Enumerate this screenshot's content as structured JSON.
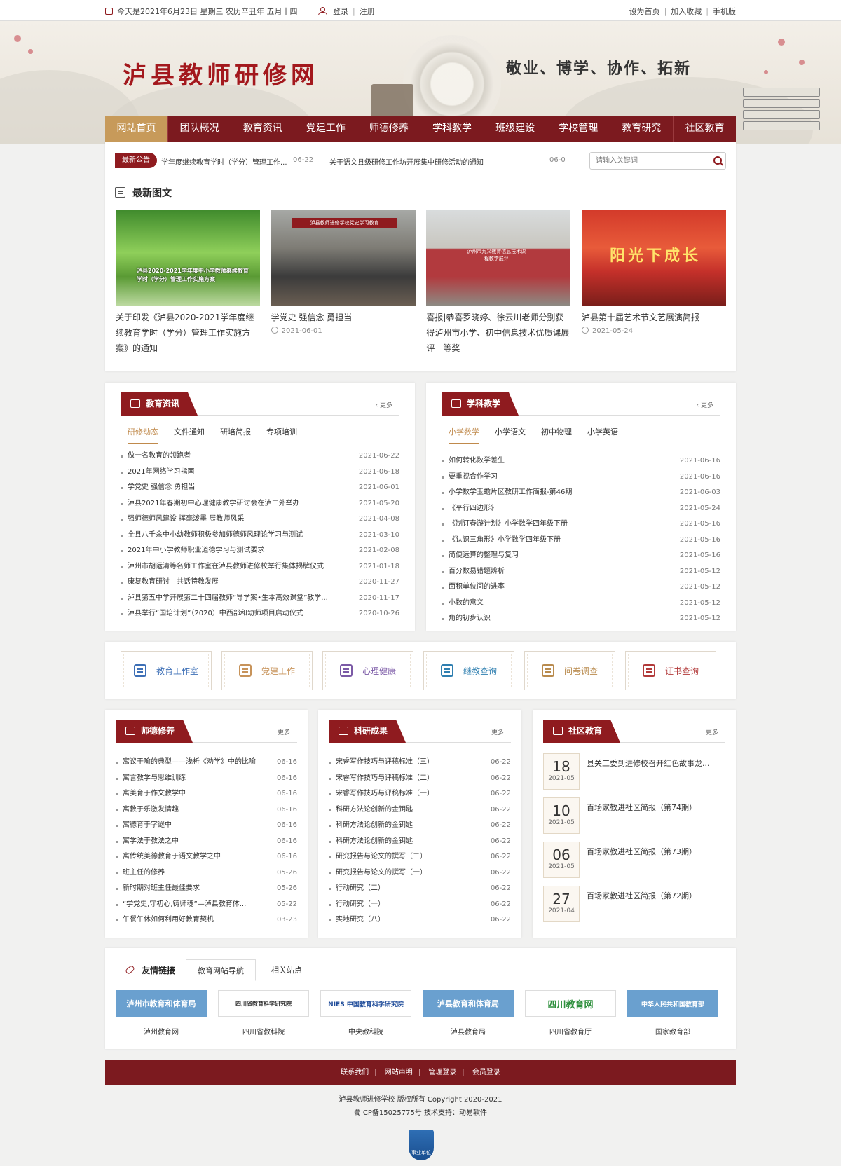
{
  "topbar": {
    "date_text": "今天是2021年6月23日 星期三 农历辛丑年 五月十四",
    "login": "登录",
    "register": "注册",
    "set_home": "设为首页",
    "add_fav": "加入收藏",
    "mobile": "手机版"
  },
  "banner": {
    "title": "泸县教师研修网",
    "motto": "敬业、博学、协作、拓新"
  },
  "nav": [
    "网站首页",
    "团队概况",
    "教育资讯",
    "党建工作",
    "师德修养",
    "学科教学",
    "班级建设",
    "学校管理",
    "教育研究",
    "社区教育"
  ],
  "notice": {
    "tag": "最新公告",
    "item1": "学年度继续教育学时（学分）管理工作...",
    "date1": "06-22",
    "item2": "关于语文县级研修工作坊开展集中研修活动的通知",
    "date2": "06-0"
  },
  "search": {
    "placeholder": "请输入关键词"
  },
  "latest": {
    "title": "最新图文",
    "items": [
      {
        "caption": "关于印发《泸县2020-2021学年度继续教育学时（学分）管理工作实施方案》的通知",
        "date": "",
        "overlay": "泸县2020-2021学年度中小学教师继续教育学时（学分）管理工作实施方案"
      },
      {
        "caption": "学党史 强信念 勇担当",
        "date": "2021-06-01",
        "overlay": "泸县教师进修学校党史学习教育"
      },
      {
        "caption": "喜报|恭喜罗晓婷、徐云川老师分别获得泸州市小学、初中信息技术优质课展评一等奖",
        "date": "",
        "overlay": "泸州市九义教育信息技术课程教学展评"
      },
      {
        "caption": "泸县第十届艺术节文艺展演简报",
        "date": "2021-05-24",
        "overlay": "阳光下成长"
      }
    ]
  },
  "edu_news": {
    "title": "教育资讯",
    "more": "更多",
    "tabs": [
      "研修动态",
      "文件通知",
      "研培简报",
      "专项培训"
    ],
    "rows": [
      {
        "t": "做一名教育的领跑者",
        "d": "2021-06-22"
      },
      {
        "t": "2021年网络学习指南",
        "d": "2021-06-18"
      },
      {
        "t": "学党史 强信念 勇担当",
        "d": "2021-06-01"
      },
      {
        "t": "泸县2021年春期初中心理健康教学研讨会在泸二外举办",
        "d": "2021-05-20"
      },
      {
        "t": "强师德师风建设 挥毫泼墨 展教师风采",
        "d": "2021-04-08"
      },
      {
        "t": "全县八千余中小幼教师积极参加师德师风理论学习与测试",
        "d": "2021-03-10"
      },
      {
        "t": "2021年中小学教师职业道德学习与测试要求",
        "d": "2021-02-08"
      },
      {
        "t": "泸州市胡运清等名师工作室在泸县教师进修校举行集体揭牌仪式",
        "d": "2021-01-18"
      },
      {
        "t": "康复教育研讨　共话特教发展",
        "d": "2020-11-27"
      },
      {
        "t": "泸县第五中学开展第二十四届教师“导学案•生本高效课堂”教学...",
        "d": "2020-11-17"
      },
      {
        "t": "泸县举行“国培计划”（2020）中西部和幼师项目启动仪式",
        "d": "2020-10-26"
      }
    ]
  },
  "subject": {
    "title": "学科教学",
    "more": "更多",
    "tabs": [
      "小学数学",
      "小学语文",
      "初中物理",
      "小学英语"
    ],
    "rows": [
      {
        "t": "如何转化数学差生",
        "d": "2021-06-16"
      },
      {
        "t": "要重视合作学习",
        "d": "2021-06-16"
      },
      {
        "t": "小学数学玉蟾片区教研工作简报-第46期",
        "d": "2021-06-03"
      },
      {
        "t": "《平行四边形》",
        "d": "2021-05-24"
      },
      {
        "t": "《制订春游计划》小学数学四年级下册",
        "d": "2021-05-16"
      },
      {
        "t": "《认识三角形》小学数学四年级下册",
        "d": "2021-05-16"
      },
      {
        "t": "简便运算的整理与复习",
        "d": "2021-05-16"
      },
      {
        "t": "百分数易错题辨析",
        "d": "2021-05-12"
      },
      {
        "t": "面积单位间的进率",
        "d": "2021-05-12"
      },
      {
        "t": "小数的意义",
        "d": "2021-05-12"
      },
      {
        "t": "角的初步认识",
        "d": "2021-05-12"
      }
    ]
  },
  "quick": [
    {
      "label": "教育工作室",
      "color": "#3d6fb6"
    },
    {
      "label": "党建工作",
      "color": "#c7935a"
    },
    {
      "label": "心理健康",
      "color": "#7b5aa6"
    },
    {
      "label": "继教查询",
      "color": "#2f7fb0"
    },
    {
      "label": "问卷调查",
      "color": "#b98b4e"
    },
    {
      "label": "证书查询",
      "color": "#b23a3a"
    }
  ],
  "ethics": {
    "title": "师德修养",
    "more": "更多",
    "rows": [
      {
        "t": "寓议于喻的典型——浅析《劝学》中的比喻",
        "d": "06-16"
      },
      {
        "t": "寓言教学与思维训练",
        "d": "06-16"
      },
      {
        "t": "寓美育于作文教学中",
        "d": "06-16"
      },
      {
        "t": "寓教于乐激发情趣",
        "d": "06-16"
      },
      {
        "t": "寓德育于字谜中",
        "d": "06-16"
      },
      {
        "t": "寓学法于教法之中",
        "d": "06-16"
      },
      {
        "t": "寓传统美德教育于语文教学之中",
        "d": "06-16"
      },
      {
        "t": "班主任的修养",
        "d": "05-26"
      },
      {
        "t": "新时期对班主任最佳要求",
        "d": "05-26"
      },
      {
        "t": "“学党史,守初心,铸师魂”—泸县教育体...",
        "d": "05-22"
      },
      {
        "t": "午餐午休如何利用好教育契机",
        "d": "03-23"
      }
    ]
  },
  "research": {
    "title": "科研成果",
    "more": "更多",
    "rows": [
      {
        "t": "宋睿写作技巧与评稿标准（三）",
        "d": "06-22"
      },
      {
        "t": "宋睿写作技巧与评稿标准（二）",
        "d": "06-22"
      },
      {
        "t": "宋睿写作技巧与评稿标准（一）",
        "d": "06-22"
      },
      {
        "t": "科研方法论创新的金钥匙",
        "d": "06-22"
      },
      {
        "t": "科研方法论创新的金钥匙",
        "d": "06-22"
      },
      {
        "t": "科研方法论创新的金钥匙",
        "d": "06-22"
      },
      {
        "t": "研究报告与论文的撰写（二）",
        "d": "06-22"
      },
      {
        "t": "研究报告与论文的撰写（一）",
        "d": "06-22"
      },
      {
        "t": "行动研究（二）",
        "d": "06-22"
      },
      {
        "t": "行动研究（一）",
        "d": "06-22"
      },
      {
        "t": "实地研究（八）",
        "d": "06-22"
      }
    ]
  },
  "community": {
    "title": "社区教育",
    "more": "更多",
    "items": [
      {
        "day": "18",
        "ym": "2021-05",
        "t": "县关工委到进修校召开红色故事龙..."
      },
      {
        "day": "10",
        "ym": "2021-05",
        "t": "百场家教进社区简报（第74期）"
      },
      {
        "day": "06",
        "ym": "2021-05",
        "t": "百场家教进社区简报（第73期）"
      },
      {
        "day": "27",
        "ym": "2021-04",
        "t": "百场家教进社区简报（第72期）"
      }
    ]
  },
  "links": {
    "title": "友情链接",
    "tab1": "教育网站导航",
    "tab2": "相关站点",
    "items": [
      {
        "logo": "泸州市教育和体育局",
        "name": "泸州教育网",
        "color": "#b8342c"
      },
      {
        "logo": "四川省教育科学研究院",
        "name": "四川省教科院",
        "color": "#333333"
      },
      {
        "logo": "NIES 中国教育科学研究院",
        "name": "中央教科院",
        "color": "#1f4c9a"
      },
      {
        "logo": "泸县教育和体育局",
        "name": "泸县教育局",
        "color": "#c2292f"
      },
      {
        "logo": "四川教育网",
        "name": "四川省教育厅",
        "color": "#2d8f3c"
      },
      {
        "logo": "中华人民共和国教育部",
        "name": "国家教育部",
        "color": "#c33"
      }
    ]
  },
  "footer": {
    "links": [
      "联系我们",
      "网站声明",
      "管理登录",
      "会员登录"
    ],
    "line1": "泸县教师进修学校  版权所有  Copyright  2020-2021",
    "line2": "蜀ICP备15025775号  技术支持：动易软件",
    "badge": "事业单位"
  }
}
